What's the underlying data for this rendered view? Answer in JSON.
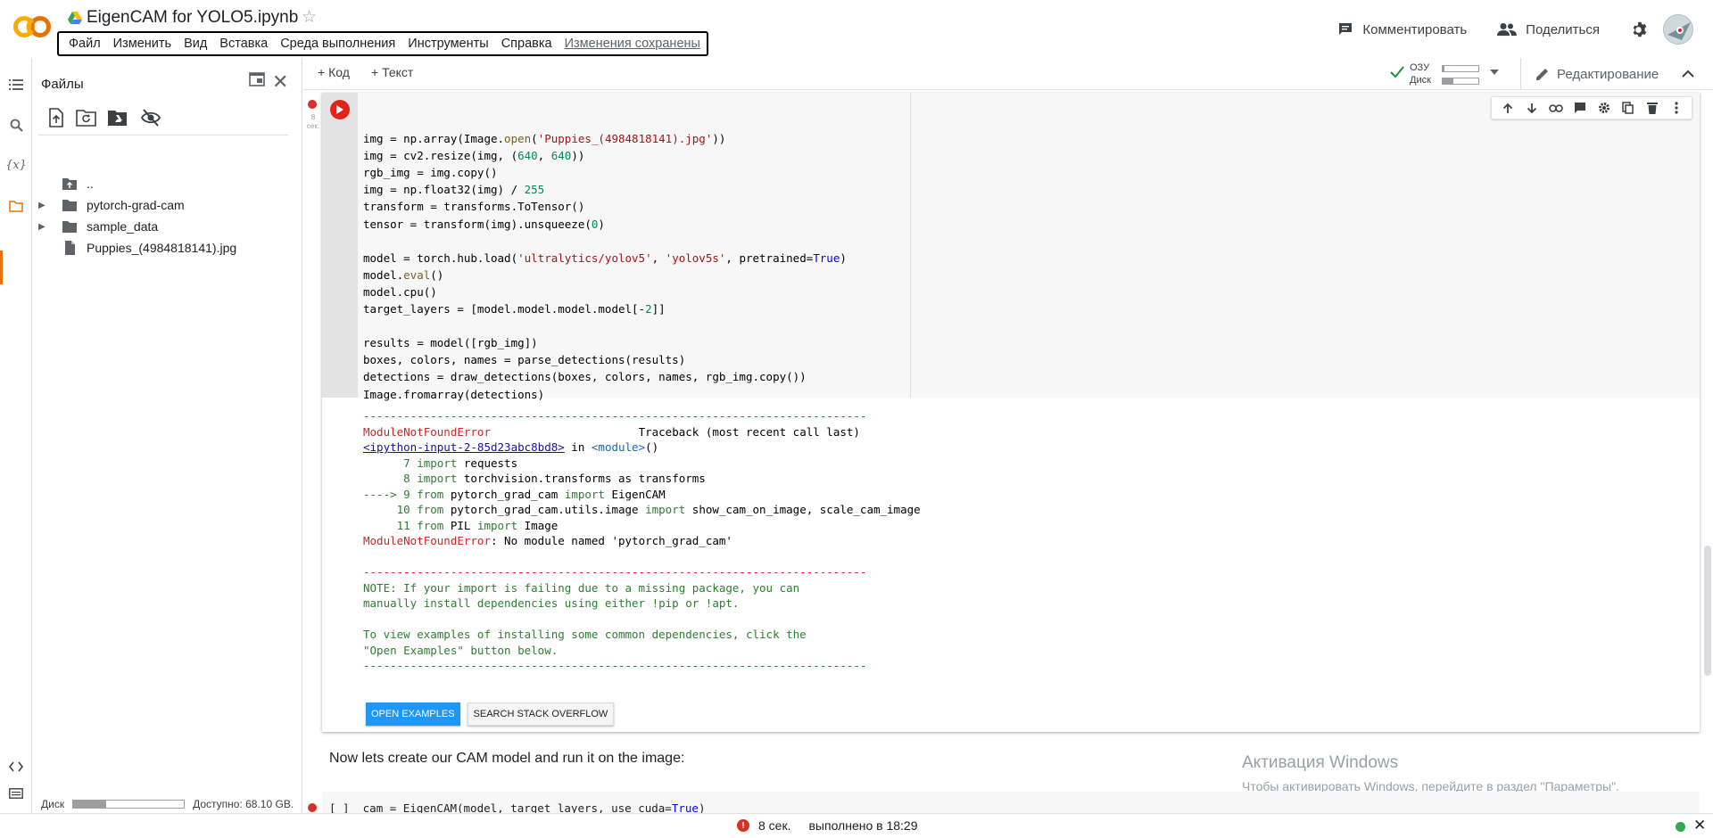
{
  "header": {
    "logo_text": "CO",
    "title": "EigenCAM for YOLO5.ipynb",
    "menu": [
      "Файл",
      "Изменить",
      "Вид",
      "Вставка",
      "Среда выполнения",
      "Инструменты",
      "Справка"
    ],
    "saved_label": "Изменения сохранены",
    "comment_label": "Комментировать",
    "share_label": "Поделиться"
  },
  "rail": {
    "icons": [
      "toc-icon",
      "search-icon",
      "variables-icon",
      "folder-icon",
      "code-snippets-icon",
      "terminal-icon"
    ],
    "variables_glyph": "{x}"
  },
  "files": {
    "title": "Файлы",
    "tree": [
      {
        "name": "..",
        "type": "up"
      },
      {
        "name": "pytorch-grad-cam",
        "type": "folder"
      },
      {
        "name": "sample_data",
        "type": "folder"
      },
      {
        "name": "Puppies_(4984818141).jpg",
        "type": "file"
      }
    ],
    "disk_label": "Диск",
    "disk_used_fraction": 0.3,
    "disk_available": "Доступно: 68.10 GB."
  },
  "toolbar": {
    "add_code": "+ Код",
    "add_text": "+ Текст",
    "ram_label": "ОЗУ",
    "disk_label": "Диск",
    "ram_used_fraction": 0.05,
    "disk_used_fraction": 0.3,
    "editing_label": "Редактирование"
  },
  "cell": {
    "exec_time": "8 сек.",
    "code_lines": [
      "",
      "img = np.array(Image.open('Puppies_(4984818141).jpg'))",
      "img = cv2.resize(img, (640, 640))",
      "rgb_img = img.copy()",
      "img = np.float32(img) / 255",
      "transform = transforms.ToTensor()",
      "tensor = transform(img).unsqueeze(0)",
      "",
      "model = torch.hub.load('ultralytics/yolov5', 'yolov5s', pretrained=True)",
      "model.eval()",
      "model.cpu()",
      "target_layers = [model.model.model.model[-2]]",
      "",
      "results = model([rgb_img])",
      "boxes, colors, names = parse_detections(results)",
      "detections = draw_detections(boxes, colors, names, rgb_img.copy())",
      "Image.fromarray(detections)"
    ],
    "output": {
      "dash_line": "---------------------------------------------------------------------------",
      "error_name": "ModuleNotFoundError",
      "traceback_label": "Traceback (most recent call last)",
      "input_link": "<ipython-input-2-85d23abc8bd8>",
      "in_text": " in ",
      "module_text": "<module>",
      "module_paren": "()",
      "tb_lines": [
        {
          "prefix": "      7 ",
          "kw": "import",
          "rest": " requests"
        },
        {
          "prefix": "      8 ",
          "kw": "import",
          "rest": " torchvision.transforms as transforms"
        },
        {
          "prefix": "----> 9 ",
          "kw": "from",
          "rest": " pytorch_grad_cam ",
          "kw2": "import",
          "rest2": " EigenCAM"
        },
        {
          "prefix": "     10 ",
          "kw": "from",
          "rest": " pytorch_grad_cam.utils.image ",
          "kw2": "import",
          "rest2": " show_cam_on_image, scale_cam_image"
        },
        {
          "prefix": "     11 ",
          "kw": "from",
          "rest": " PIL ",
          "kw2": "import",
          "rest2": " Image"
        }
      ],
      "final_error": ": No module named 'pytorch_grad_cam'",
      "note_lines": [
        "NOTE: If your import is failing due to a missing package, you can",
        "manually install dependencies using either !pip or !apt.",
        "",
        "To view examples of installing some common dependencies, click the",
        "\"Open Examples\" button below."
      ],
      "open_examples": "OPEN EXAMPLES",
      "search_so": "SEARCH STACK OVERFLOW"
    }
  },
  "text_cell": "Now lets create our CAM model and run it on the image:",
  "next_cell": {
    "bracket": "[ ]",
    "code": "cam = EigenCAM(model, target_layers, use_cuda=True)"
  },
  "watermark": {
    "title": "Активация Windows",
    "subtitle": "Чтобы активировать Windows, перейдите в раздел \"Параметры\"."
  },
  "status": {
    "error_glyph": "!",
    "time": "8 сек.",
    "completed": "выполнено в 18:29"
  },
  "colors": {
    "accent_orange": "#e8710a",
    "run_error_red": "#e0241b",
    "open_examples_blue": "#2196f3",
    "status_green": "#34a853"
  }
}
